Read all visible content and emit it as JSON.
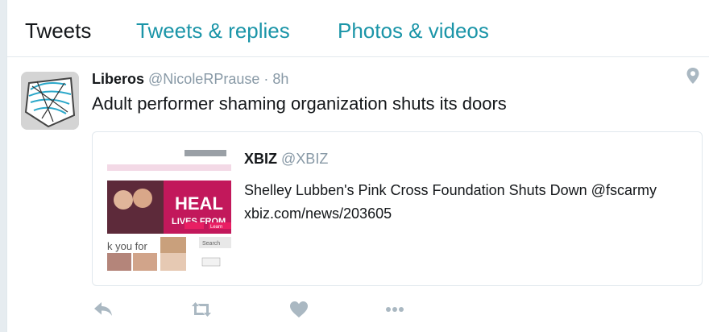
{
  "tabs": [
    {
      "label": "Tweets",
      "active": true
    },
    {
      "label": "Tweets & replies",
      "active": false
    },
    {
      "label": "Photos & videos",
      "active": false
    }
  ],
  "tweet": {
    "author_name": "Liberos",
    "author_handle": "@NicoleRPrause",
    "separator": "·",
    "time": "8h",
    "text": "Adult performer shaming organization shuts its doors",
    "location_icon": "map-pin-icon",
    "card": {
      "name": "XBIZ",
      "handle": "@XBIZ",
      "text": "Shelley Lubben's Pink Cross Foundation Shuts Down @fscarmy xbiz.com/news/203605",
      "thumbnail": {
        "headline": "HEAL",
        "subline": "LIVES FROM",
        "partial_text": "k you for",
        "button": "Learn",
        "side_label": "Search"
      }
    },
    "actions": [
      "reply-icon",
      "retweet-icon",
      "like-icon",
      "more-icon"
    ]
  },
  "colors": {
    "accent": "#1b95a8",
    "muted": "#8899a6",
    "text": "#14171a",
    "border": "#e1e8ed",
    "action_icon": "#aab8c2"
  }
}
